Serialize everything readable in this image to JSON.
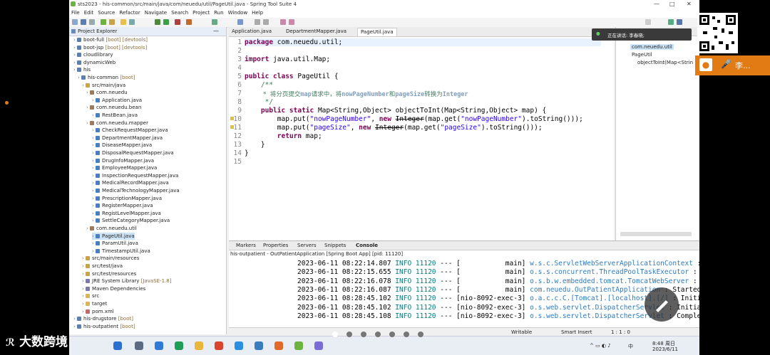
{
  "window": {
    "title": "sts2023 - his-common/src/main/java/com/neuedu/util/PageUtil.java - Spring Tool Suite 4"
  },
  "menu": [
    "File",
    "Edit",
    "Source",
    "Refactor",
    "Navigate",
    "Search",
    "Project",
    "Run",
    "Window",
    "Help"
  ],
  "explorer": {
    "title": "Project Explorer",
    "items": [
      {
        "label": "boot-full",
        "decor": "[boot] [devtools]"
      },
      {
        "label": "boot-jsp",
        "decor": "[boot] [devtools]"
      },
      {
        "label": "cloudlibrary",
        "decor": ""
      },
      {
        "label": "dynamicWeb",
        "decor": ""
      },
      {
        "label": "his",
        "decor": ""
      },
      {
        "label": "his-common",
        "decor": "[boot]"
      },
      {
        "label": "src/main/java",
        "decor": ""
      },
      {
        "label": "com.neuedu",
        "decor": ""
      },
      {
        "label": "Application.java",
        "decor": ""
      },
      {
        "label": "com.neuedu.bean",
        "decor": ""
      },
      {
        "label": "RestBean.java",
        "decor": ""
      },
      {
        "label": "com.neuedu.mapper",
        "decor": ""
      },
      {
        "label": "CheckRequestMapper.java",
        "decor": ""
      },
      {
        "label": "DepartmentMapper.java",
        "decor": ""
      },
      {
        "label": "DiseaseMapper.java",
        "decor": ""
      },
      {
        "label": "DisposalRequestMapper.java",
        "decor": ""
      },
      {
        "label": "DrugInfoMapper.java",
        "decor": ""
      },
      {
        "label": "EmployeeMapper.java",
        "decor": ""
      },
      {
        "label": "InspectionRequestMapper.java",
        "decor": ""
      },
      {
        "label": "MedicalRecordMapper.java",
        "decor": ""
      },
      {
        "label": "MedicalTechnologyMapper.java",
        "decor": ""
      },
      {
        "label": "PrescriptionMapper.java",
        "decor": ""
      },
      {
        "label": "RegisterMapper.java",
        "decor": ""
      },
      {
        "label": "RegistLevelMapper.java",
        "decor": ""
      },
      {
        "label": "SettleCategoryMapper.java",
        "decor": ""
      },
      {
        "label": "com.neuedu.util",
        "decor": ""
      },
      {
        "label": "PageUtil.java",
        "decor": ""
      },
      {
        "label": "ParamUtil.java",
        "decor": ""
      },
      {
        "label": "TimestampUtil.java",
        "decor": ""
      },
      {
        "label": "src/main/resources",
        "decor": ""
      },
      {
        "label": "src/test/java",
        "decor": ""
      },
      {
        "label": "src/test/resources",
        "decor": ""
      },
      {
        "label": "JRE System Library",
        "decor": "[JavaSE-1.8]"
      },
      {
        "label": "Maven Dependencies",
        "decor": ""
      },
      {
        "label": "src",
        "decor": ""
      },
      {
        "label": "target",
        "decor": ""
      },
      {
        "label": "pom.xml",
        "decor": ""
      },
      {
        "label": "his-drugstore",
        "decor": "[boot]"
      },
      {
        "label": "his-outpatient",
        "decor": "[boot]"
      }
    ]
  },
  "editor": {
    "tabs": [
      "Application.java",
      "DepartmentMapper.java",
      "PageUtil.java"
    ],
    "lines": [
      "1",
      "2",
      "3",
      "4",
      "5",
      "6",
      "7",
      "8",
      "9",
      "10",
      "11",
      "12",
      "13",
      "14",
      "15"
    ],
    "code": {
      "l1_kw": "package",
      "l1_rest": " com.neuedu.util;",
      "l3_kw": "import",
      "l3_rest": " java.util.Map;",
      "l5_kw": "public class",
      "l5_rest": " PageUtil {",
      "l6": "    /**",
      "l7_a": "     * 将分页提交",
      "l7_b": "map",
      "l7_c": "请求中，将",
      "l7_d": "nowPageNumber",
      "l7_e": "和",
      "l7_f": "pageSize",
      "l7_g": "转换为",
      "l7_h": "Integer",
      "l8": "     */",
      "l9_kw": "    public static",
      "l9_rest": " Map<String,Object> objectToInt(Map<String,Object> map) {",
      "l10_a": "        map.put(",
      "l10_s1": "\"nowPageNumber\"",
      "l10_b": ", ",
      "l10_kw": "new",
      "l10_c": " ",
      "l10_strike": "Integer",
      "l10_d": "(map.get(",
      "l10_s2": "\"nowPageNumber\"",
      "l10_e": ").toString()));",
      "l11_a": "        map.put(",
      "l11_s1": "\"pageSize\"",
      "l11_b": ", ",
      "l11_kw": "new",
      "l11_c": " ",
      "l11_strike": "Integer",
      "l11_d": "(map.get(",
      "l11_s2": "\"pageSize\"",
      "l11_e": ").toString()));",
      "l12_kw": "        return",
      "l12_rest": " map;",
      "l13": "    }",
      "l14": "}"
    }
  },
  "outline": {
    "items": [
      "com.neuedu.util",
      "PageUtil",
      "objectToInt(Map<Strin"
    ]
  },
  "console": {
    "tabs": [
      "Markers",
      "Properties",
      "Servers",
      "Snippets",
      "Console"
    ],
    "info": "his-outpatient - OutPatientApplication [Spring Boot App]  [pid: 11120]",
    "rows": [
      {
        "ts": "2023-06-11 08:22:14.807",
        "lvl": "INFO",
        "pid": "11120",
        "sep": "---",
        "th": "[           main]",
        "cls": "w.s.c.ServletWebServerApplicationContext",
        "msg": ": Root Web"
      },
      {
        "ts": "2023-06-11 08:22:15.655",
        "lvl": "INFO",
        "pid": "11120",
        "sep": "---",
        "th": "[           main]",
        "cls": "o.s.s.concurrent.ThreadPoolTaskExecutor",
        "msg": ": Initiali"
      },
      {
        "ts": "2023-06-11 08:22:16.078",
        "lvl": "INFO",
        "pid": "11120",
        "sep": "---",
        "th": "[           main]",
        "cls": "o.s.b.w.embedded.tomcat.TomcatWebServer",
        "msg": ": Tomcat s"
      },
      {
        "ts": "2023-06-11 08:22:16.087",
        "lvl": "INFO",
        "pid": "11120",
        "sep": "---",
        "th": "[           main]",
        "cls": "com.neuedu.OutPatientApplication",
        "msg": ": Started"
      },
      {
        "ts": "2023-06-11 08:28:45.102",
        "lvl": "INFO",
        "pid": "11120",
        "sep": "---",
        "th": "[nio-8092-exec-3]",
        "cls": "o.a.c.c.C.[Tomcat].[localhost].[/]",
        "msg": ": Initiali"
      },
      {
        "ts": "2023-06-11 08:28:45.102",
        "lvl": "INFO",
        "pid": "11120",
        "sep": "---",
        "th": "[nio-8092-exec-3]",
        "cls": "o.s.web.servlet.DispatcherServlet",
        "msg": ": Initiali"
      },
      {
        "ts": "2023-06-11 08:28:45.108",
        "lvl": "INFO",
        "pid": "11120",
        "sep": "---",
        "th": "[nio-8092-exec-3]",
        "cls": "o.s.web.servlet.DispatcherServlet",
        "msg": ": Complete"
      }
    ]
  },
  "statusbar": {
    "writable": "Writable",
    "insert": "Smart Insert",
    "pos": "1 : 1 : 0"
  },
  "taskbar": {
    "time": "8:48 周日",
    "date": "2023/6/11",
    "ime": "中"
  },
  "overlay": {
    "speaking": "正在讲话: 李春晓;",
    "user": "李..."
  },
  "watermark": "大数跨境"
}
